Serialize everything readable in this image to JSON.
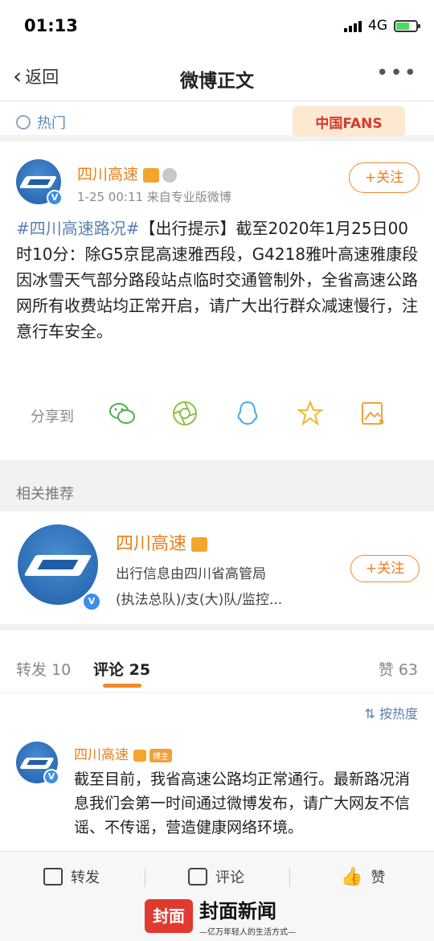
{
  "status_bar": {
    "time": "01:13",
    "network": "4G"
  },
  "nav": {
    "back_label": "返回",
    "title": "微博正文",
    "more": "•••"
  },
  "hot": {
    "label": "热门",
    "fans_badge": "中国FANS"
  },
  "post": {
    "author": "四川高速",
    "meta": "1-25 00:11  来自专业版微博",
    "follow_label": "+关注",
    "topic": "#四川高速路况#",
    "text": "【出行提示】截至2020年1月25日00时10分：除G5京昆高速雅西段，G4218雅叶高速雅康段因冰雪天气部分路段站点临时交通管制外，全省高速公路网所有收费站均正常开启，请广大出行群众减速慢行，注意行车安全。",
    "share_label": "分享到"
  },
  "recommend": {
    "title": "相关推荐",
    "name": "四川高速",
    "desc_line1": "出行信息由四川省高管局",
    "desc_line2": "(执法总队)/支(大)队/监控...",
    "follow_label": "+关注"
  },
  "tabs": {
    "repost": "转发 10",
    "comments": "评论 25",
    "likes": "赞 63"
  },
  "sort": {
    "label": "按热度"
  },
  "comment": {
    "author": "四川高速",
    "host_tag": "博主",
    "text": "截至目前，我省高速公路均正常通行。最新路况消息我们会第一时间通过微博发布，请广大网友不信谣、不传谣，营造健康网络环境。"
  },
  "bottom_bar": {
    "repost": "转发",
    "comment": "评论",
    "like": "赞"
  },
  "watermark": {
    "box": "封面",
    "main": "封面新闻",
    "sub": "—亿万年轻人的生活方式—"
  },
  "colors": {
    "accent_orange": "#e8801a",
    "link_blue": "#5b7fb1",
    "verified_blue": "#3c8ee8"
  }
}
